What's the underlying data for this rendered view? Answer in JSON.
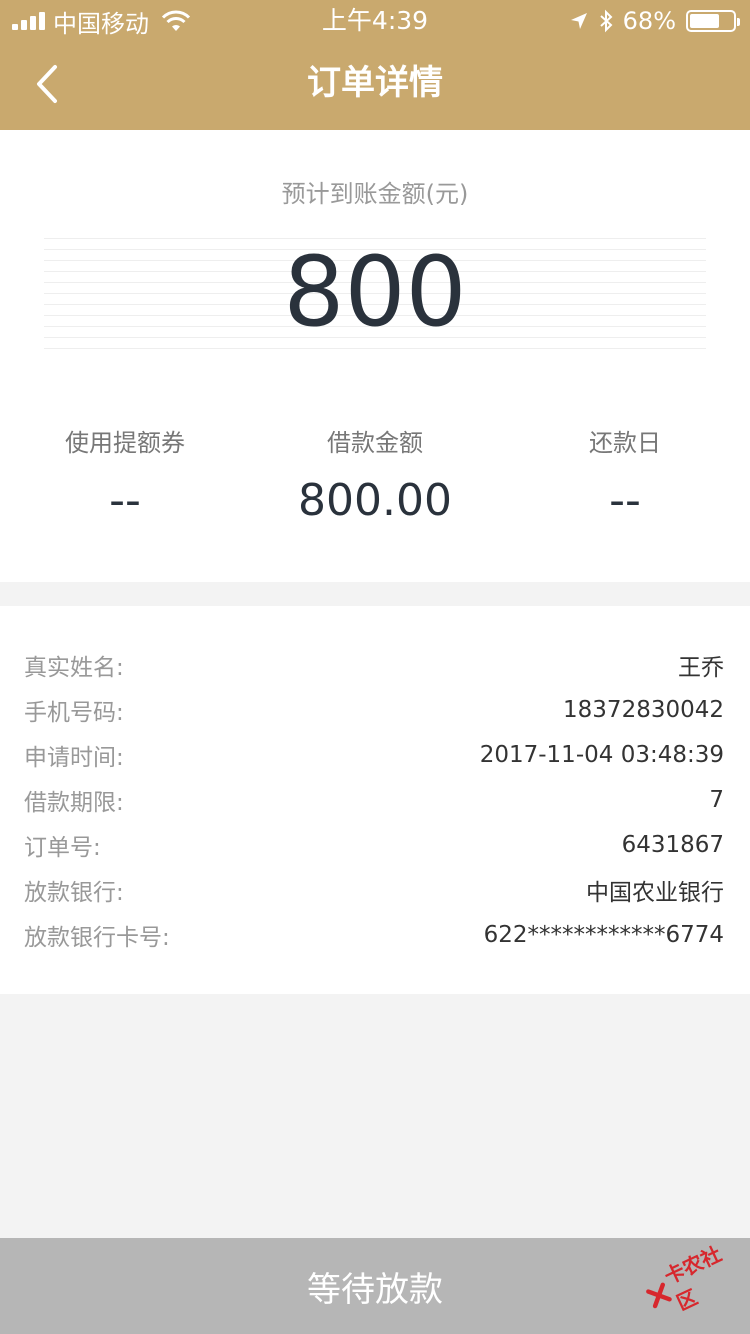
{
  "status_bar": {
    "carrier": "中国移动",
    "time": "上午4:39",
    "battery_percent": "68%",
    "battery_level": 0.68
  },
  "nav": {
    "title": "订单详情",
    "back_icon": "chevron-left-icon"
  },
  "amount": {
    "label": "预计到账金额(元)",
    "value": "800"
  },
  "summary": {
    "coupon_label": "使用提额券",
    "coupon_value": "--",
    "loan_amount_label": "借款金额",
    "loan_amount_value": "800.00",
    "repay_date_label": "还款日",
    "repay_date_value": "--"
  },
  "details": [
    {
      "label": "真实姓名:",
      "value": "王乔"
    },
    {
      "label": "手机号码:",
      "value": "18372830042"
    },
    {
      "label": "申请时间:",
      "value": "2017-11-04 03:48:39"
    },
    {
      "label": "借款期限:",
      "value": "7"
    },
    {
      "label": "订单号:",
      "value": "6431867"
    },
    {
      "label": "放款银行:",
      "value": "中国农业银行"
    },
    {
      "label": "放款银行卡号:",
      "value": "622************6774"
    }
  ],
  "bottom_button": {
    "label": "等待放款"
  },
  "watermark": {
    "text": "卡农社区"
  },
  "colors": {
    "header_bg": "#c9a96e",
    "button_bg": "#b6b6b6",
    "amount_text": "#2a323c"
  }
}
